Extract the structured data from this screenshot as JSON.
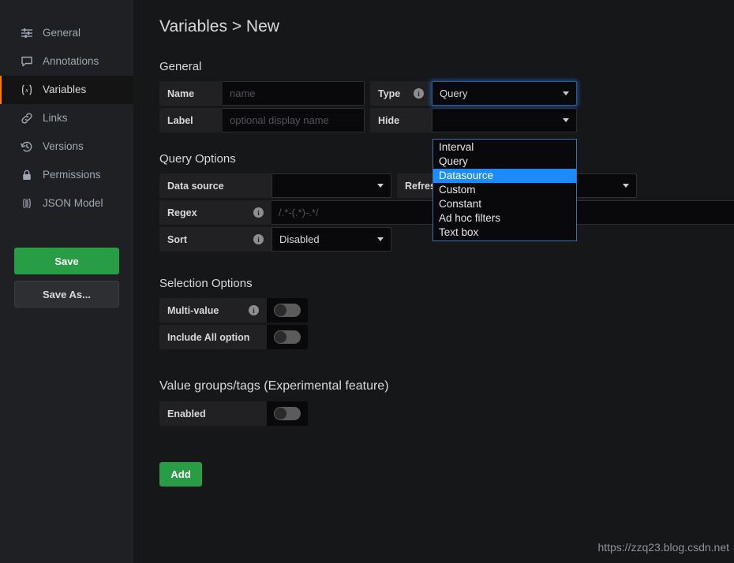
{
  "sidebar": {
    "items": [
      {
        "label": "General",
        "icon": "sliders-icon",
        "active": false
      },
      {
        "label": "Annotations",
        "icon": "comment-icon",
        "active": false
      },
      {
        "label": "Variables",
        "icon": "variable-icon",
        "active": true
      },
      {
        "label": "Links",
        "icon": "link-icon",
        "active": false
      },
      {
        "label": "Versions",
        "icon": "history-icon",
        "active": false
      },
      {
        "label": "Permissions",
        "icon": "lock-icon",
        "active": false
      },
      {
        "label": "JSON Model",
        "icon": "brackets-icon",
        "active": false
      }
    ],
    "save_label": "Save",
    "save_as_label": "Save As..."
  },
  "main": {
    "page_title": "Variables > New",
    "sections": {
      "general": "General",
      "query_options": "Query Options",
      "selection_options": "Selection Options",
      "value_groups": "Value groups/tags (Experimental feature)"
    },
    "fields": {
      "name_label": "Name",
      "name_placeholder": "name",
      "name_value": "",
      "label_label": "Label",
      "label_placeholder": "optional display name",
      "label_value": "",
      "type_label": "Type",
      "type_value": "Query",
      "hide_label": "Hide",
      "hide_value": "",
      "datasource_label": "Data source",
      "datasource_value": "",
      "refresh_label": "Refresh",
      "refresh_value": "",
      "regex_label": "Regex",
      "regex_placeholder": "/.*-(.*)-.*/",
      "regex_value": "",
      "sort_label": "Sort",
      "sort_value": "Disabled",
      "multivalue_label": "Multi-value",
      "multivalue_state": "off",
      "includeall_label": "Include All option",
      "includeall_state": "off",
      "enabled_label": "Enabled",
      "enabled_state": "off"
    },
    "add_label": "Add",
    "watermark": "https://zzq23.blog.csdn.net"
  },
  "type_dropdown": {
    "open": true,
    "selected": "Datasource",
    "options": [
      "Interval",
      "Query",
      "Datasource",
      "Custom",
      "Constant",
      "Ad hoc filters",
      "Text box"
    ]
  },
  "colors": {
    "accent_orange": "#ff780a",
    "primary_green": "#299c46",
    "highlight_blue": "#1a8cff",
    "focus_blue": "#245da8",
    "panel_bg": "#161719",
    "sidebar_bg": "#1f2023",
    "input_bg": "#09090b",
    "label_bg": "#212124"
  }
}
